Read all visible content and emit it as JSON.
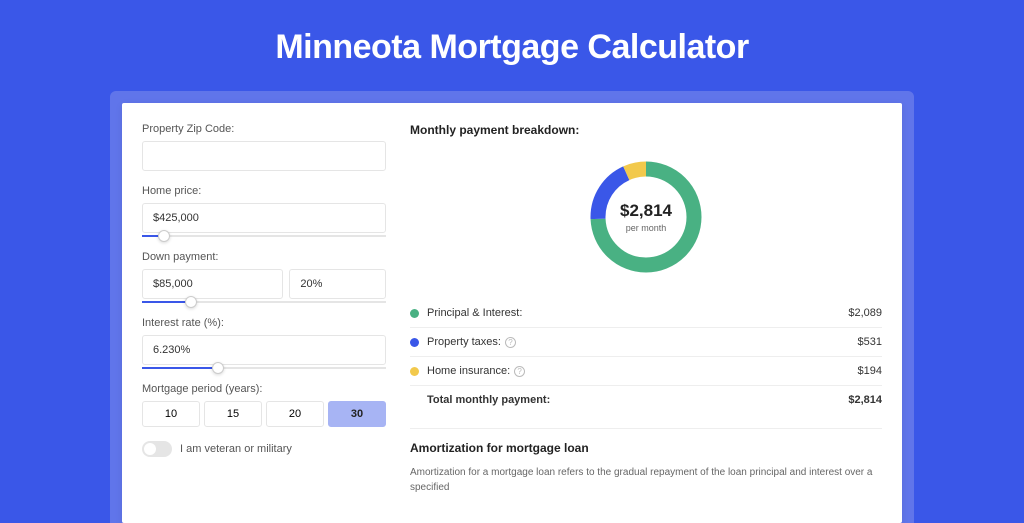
{
  "title": "Minneota Mortgage Calculator",
  "form": {
    "zip_label": "Property Zip Code:",
    "zip_value": "",
    "price_label": "Home price:",
    "price_value": "$425,000",
    "price_slider_pct": 9,
    "down_label": "Down payment:",
    "down_amount": "$85,000",
    "down_pct": "20%",
    "down_slider_pct": 20,
    "rate_label": "Interest rate (%):",
    "rate_value": "6.230%",
    "rate_slider_pct": 31,
    "period_label": "Mortgage period (years):",
    "periods": [
      "10",
      "15",
      "20",
      "30"
    ],
    "period_active": "30",
    "veteran_label": "I am veteran or military"
  },
  "breakdown": {
    "heading": "Monthly payment breakdown:",
    "center_amount": "$2,814",
    "center_sub": "per month",
    "items": [
      {
        "label": "Principal & Interest:",
        "value": "$2,089",
        "color": "#49b183",
        "info": false
      },
      {
        "label": "Property taxes:",
        "value": "$531",
        "color": "#3a57e8",
        "info": true
      },
      {
        "label": "Home insurance:",
        "value": "$194",
        "color": "#f2c94c",
        "info": true
      }
    ],
    "total_label": "Total monthly payment:",
    "total_value": "$2,814"
  },
  "chart_data": {
    "type": "pie",
    "title": "Monthly payment breakdown",
    "series": [
      {
        "name": "Principal & Interest",
        "value": 2089,
        "color": "#49b183"
      },
      {
        "name": "Property taxes",
        "value": 531,
        "color": "#3a57e8"
      },
      {
        "name": "Home insurance",
        "value": 194,
        "color": "#f2c94c"
      }
    ],
    "total": 2814,
    "unit": "USD/month"
  },
  "amort": {
    "heading": "Amortization for mortgage loan",
    "body": "Amortization for a mortgage loan refers to the gradual repayment of the loan principal and interest over a specified"
  }
}
